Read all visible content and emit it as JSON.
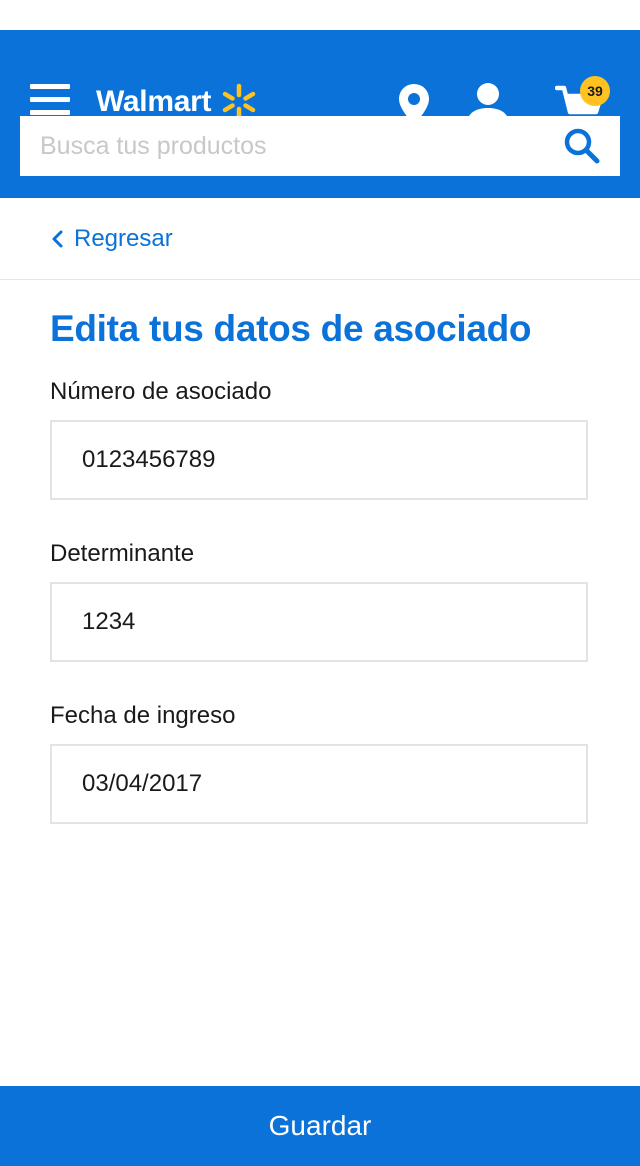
{
  "header": {
    "logo_text": "Walmart",
    "cart_count": "39",
    "search_placeholder": "Busca tus productos",
    "colors": {
      "brand_blue": "#0a72d8",
      "spark_yellow": "#ffc220"
    },
    "icons": [
      "menu-icon",
      "walmart-spark-icon",
      "location-pin-icon",
      "user-icon",
      "cart-icon",
      "search-icon"
    ]
  },
  "nav": {
    "back_label": "Regresar"
  },
  "form": {
    "title": "Edita tus datos de asociado",
    "fields": [
      {
        "label": "Número de asociado",
        "value": "0123456789"
      },
      {
        "label": "Determinante",
        "value": "1234"
      },
      {
        "label": "Fecha de ingreso",
        "value": "03/04/2017"
      }
    ],
    "save_label": "Guardar"
  }
}
